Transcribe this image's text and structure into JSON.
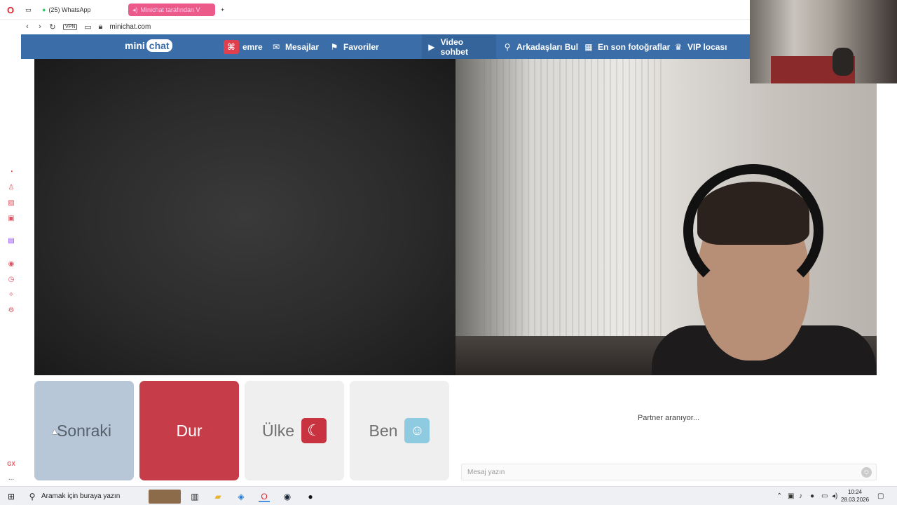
{
  "browser": {
    "tabs": [
      {
        "label": "(25) WhatsApp"
      },
      {
        "label": "Minichat tarafından V"
      }
    ],
    "new_tab": "+",
    "vpn": "VPN",
    "url": "minichat.com",
    "sidebar_bottom": "GX",
    "sidebar_more": "..."
  },
  "nav": {
    "logo_mini": "mini",
    "logo_chat": "chat",
    "items": [
      {
        "label": "emre",
        "icon": "gamepad-icon"
      },
      {
        "label": "Mesajlar",
        "icon": "envelope-icon"
      },
      {
        "label": "Favoriler",
        "icon": "bookmark-icon"
      },
      {
        "label": "Video sohbet",
        "icon": "video-icon"
      },
      {
        "label": "Arkadaşları Bul",
        "icon": "search-icon"
      },
      {
        "label": "En son fotoğraflar",
        "icon": "grid-icon"
      },
      {
        "label": "VIP locası",
        "icon": "crown-icon"
      }
    ],
    "color": "#3b6da8"
  },
  "controls": {
    "next": "Sonraki",
    "stop": "Dur",
    "country": "Ülke",
    "me": "Ben"
  },
  "chat": {
    "status": "Partner aranıyor...",
    "placeholder": "Mesaj yazın"
  },
  "taskbar": {
    "search_placeholder": "Aramak için buraya yazın",
    "time": "10:24",
    "date": "28.03.2026"
  }
}
